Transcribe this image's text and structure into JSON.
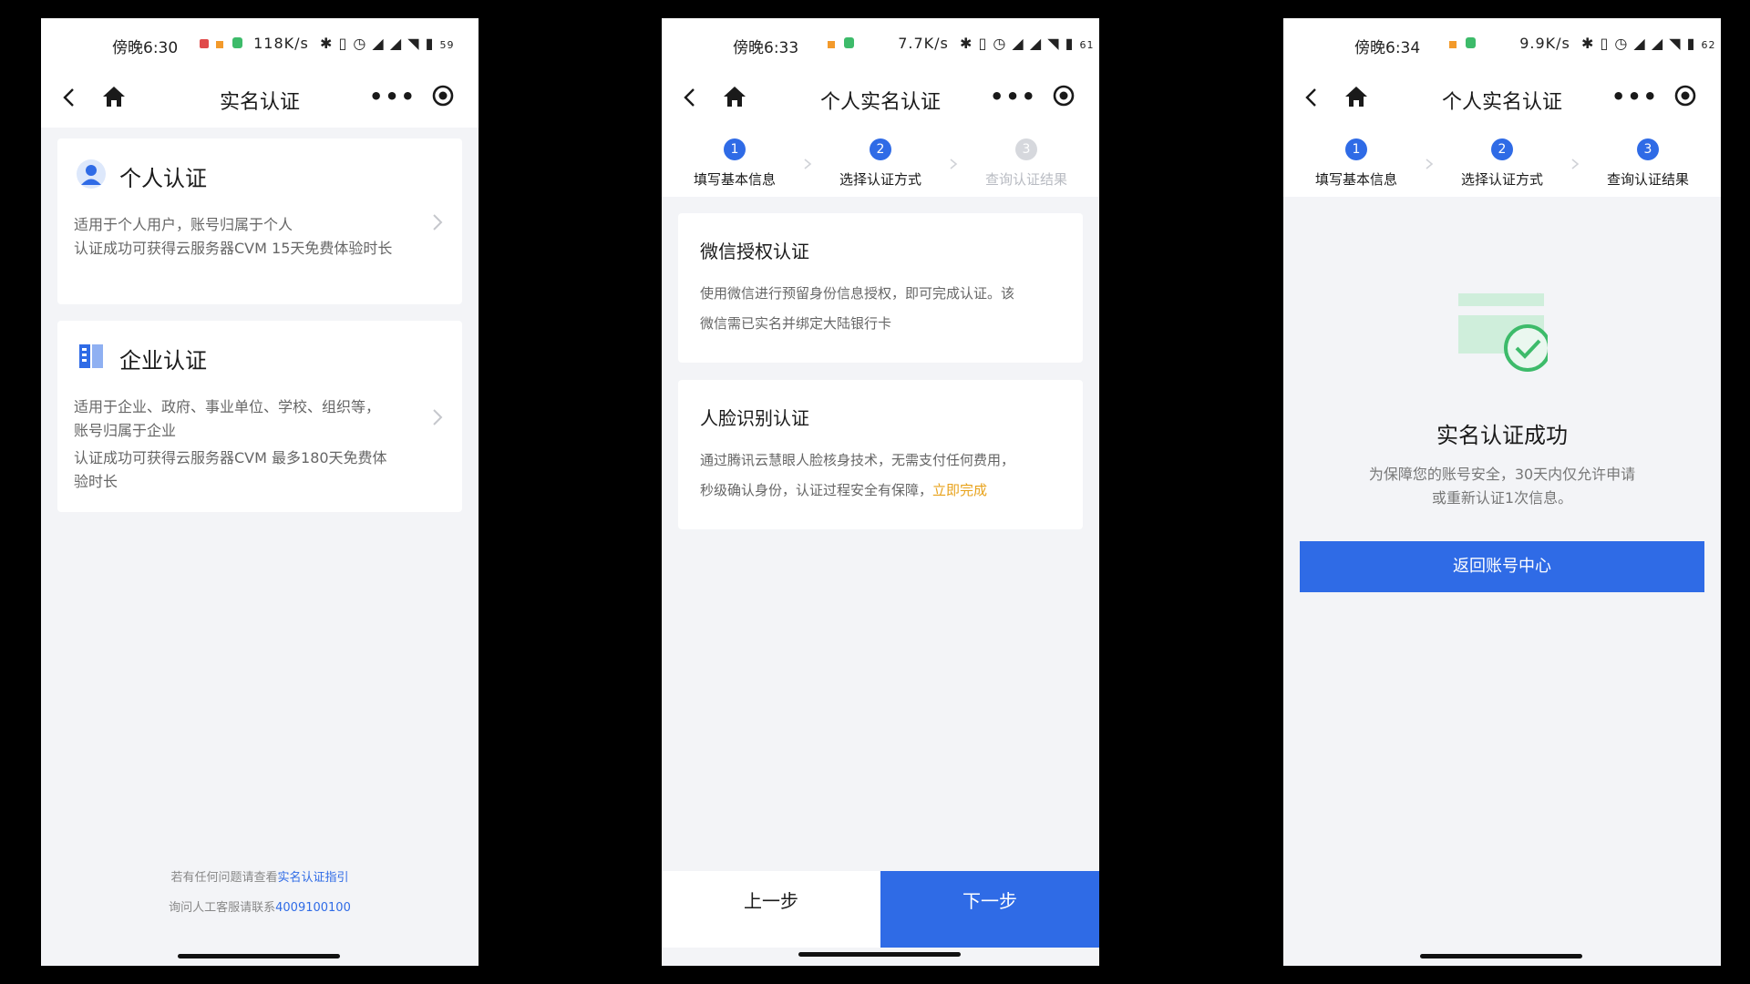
{
  "screen1": {
    "status": {
      "time": "傍晚6:30",
      "netspeed": "118K/s",
      "battery": "59"
    },
    "nav_title": "实名认证",
    "personal": {
      "title": "个人认证",
      "desc_line1": "适用于个人用户，账号归属于个人",
      "desc_line2": "认证成功可获得云服务器CVM 15天免费体验时长"
    },
    "enterprise": {
      "title": "企业认证",
      "desc_line1": "适用于企业、政府、事业单位、学校、组织等，",
      "desc_line2": "账号归属于企业",
      "desc_line3": "认证成功可获得云服务器CVM 最多180天免费体",
      "desc_line4": "验时长"
    },
    "footer": {
      "help_prefix": "若有任何问题请查看",
      "help_link": "实名认证指引",
      "contact_prefix": "询问人工客服请联系",
      "phone": "4009100100"
    }
  },
  "screen2": {
    "status": {
      "time": "傍晚6:33",
      "netspeed": "7.7K/s",
      "battery": "61"
    },
    "nav_title": "个人实名认证",
    "steps": [
      {
        "num": "1",
        "label": "填写基本信息"
      },
      {
        "num": "2",
        "label": "选择认证方式"
      },
      {
        "num": "3",
        "label": "查询认证结果"
      }
    ],
    "wechat": {
      "title": "微信授权认证",
      "desc_line1": "使用微信进行预留身份信息授权，即可完成认证。该",
      "desc_line2": "微信需已实名并绑定大陆银行卡"
    },
    "face": {
      "title": "人脸识别认证",
      "desc_line1": "通过腾讯云慧眼人脸核身技术，无需支付任何费用，",
      "desc_line2": "秒级确认身份，认证过程安全有保障，",
      "desc_link": "立即完成"
    },
    "prev_label": "上一步",
    "next_label": "下一步"
  },
  "screen3": {
    "status": {
      "time": "傍晚6:34",
      "netspeed": "9.9K/s",
      "battery": "62"
    },
    "nav_title": "个人实名认证",
    "steps": [
      {
        "num": "1",
        "label": "填写基本信息"
      },
      {
        "num": "2",
        "label": "选择认证方式"
      },
      {
        "num": "3",
        "label": "查询认证结果"
      }
    ],
    "success_title": "实名认证成功",
    "success_desc_line1": "为保障您的账号安全，30天内仅允许申请",
    "success_desc_line2": "或重新认证1次信息。",
    "return_label": "返回账号中心"
  },
  "colors": {
    "primary": "#2f6be6",
    "link_orange": "#e8a21a",
    "success_green": "#3dbb6a",
    "bg": "#f3f4f7"
  }
}
